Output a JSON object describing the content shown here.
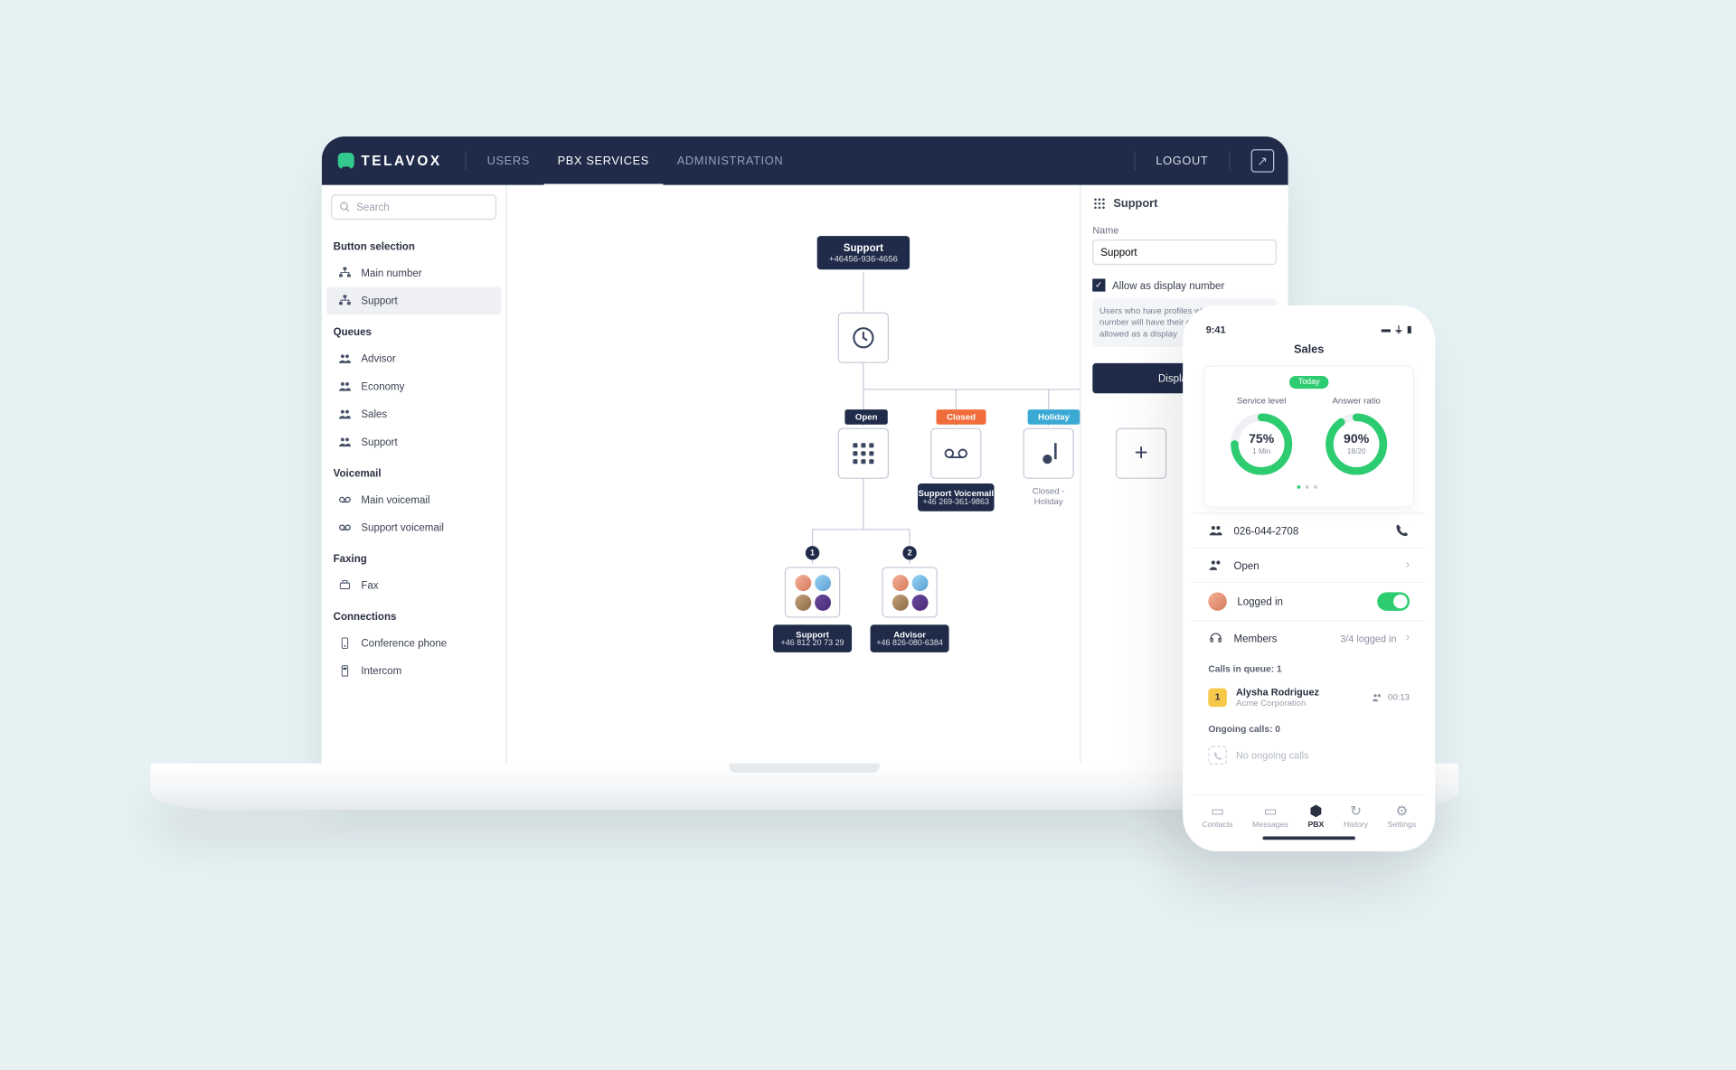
{
  "header": {
    "brand": "TELAVOX",
    "nav": {
      "users": "USERS",
      "pbx": "PBX SERVICES",
      "admin": "ADMINISTRATION"
    },
    "logout": "LOGOUT"
  },
  "sidebar": {
    "search_placeholder": "Search",
    "sections": {
      "button_sel": {
        "title": "Button selection",
        "items": [
          "Main number",
          "Support"
        ]
      },
      "queues": {
        "title": "Queues",
        "items": [
          "Advisor",
          "Economy",
          "Sales",
          "Support"
        ]
      },
      "voicemail": {
        "title": "Voicemail",
        "items": [
          "Main voicemail",
          "Support voicemail"
        ]
      },
      "faxing": {
        "title": "Faxing",
        "items": [
          "Fax"
        ]
      },
      "connections": {
        "title": "Connections",
        "items": [
          "Conference phone",
          "Intercom"
        ]
      }
    }
  },
  "flow": {
    "root": {
      "title": "Support",
      "number": "+46456-936-4656"
    },
    "tags": {
      "open": "Open",
      "closed": "Closed",
      "holiday": "Holiday"
    },
    "vm_card": {
      "title": "Support Voicemail",
      "number": "+46 269-361-9863"
    },
    "holiday_caption": "Closed - Holiday",
    "badges": {
      "b1": "1",
      "b2": "2"
    },
    "team1": {
      "title": "Support",
      "number": "+46 812 20 73 29"
    },
    "team2": {
      "title": "Advisor",
      "number": "+46 826-080-6384"
    }
  },
  "panel": {
    "title": "Support",
    "name_label": "Name",
    "name_value": "Support",
    "allow_label": "Allow as display number",
    "hint": "Users who have profiles where this display number will have their display number is not allowed as a display",
    "button": "Display call"
  },
  "phone": {
    "time": "9:41",
    "title": "Sales",
    "today": "Today",
    "g1": {
      "label": "Service level",
      "pct": "75%",
      "sub": "1 Min"
    },
    "g2": {
      "label": "Answer ratio",
      "pct": "90%",
      "sub": "18/20"
    },
    "rows": {
      "number": "026-044-2708",
      "status": "Open",
      "logged": "Logged in",
      "members": "Members",
      "members_v": "3/4 logged in"
    },
    "queue": {
      "title": "Calls in queue: 1",
      "caller": "Alysha Rodriguez",
      "org": "Acme Corporation",
      "time": "00:13",
      "badge": "1"
    },
    "ongoing": {
      "title": "Ongoing calls: 0",
      "empty": "No ongoing calls"
    },
    "tabs": {
      "contacts": "Contacts",
      "messages": "Messages",
      "pbx": "PBX",
      "history": "History",
      "settings": "Settings"
    }
  }
}
